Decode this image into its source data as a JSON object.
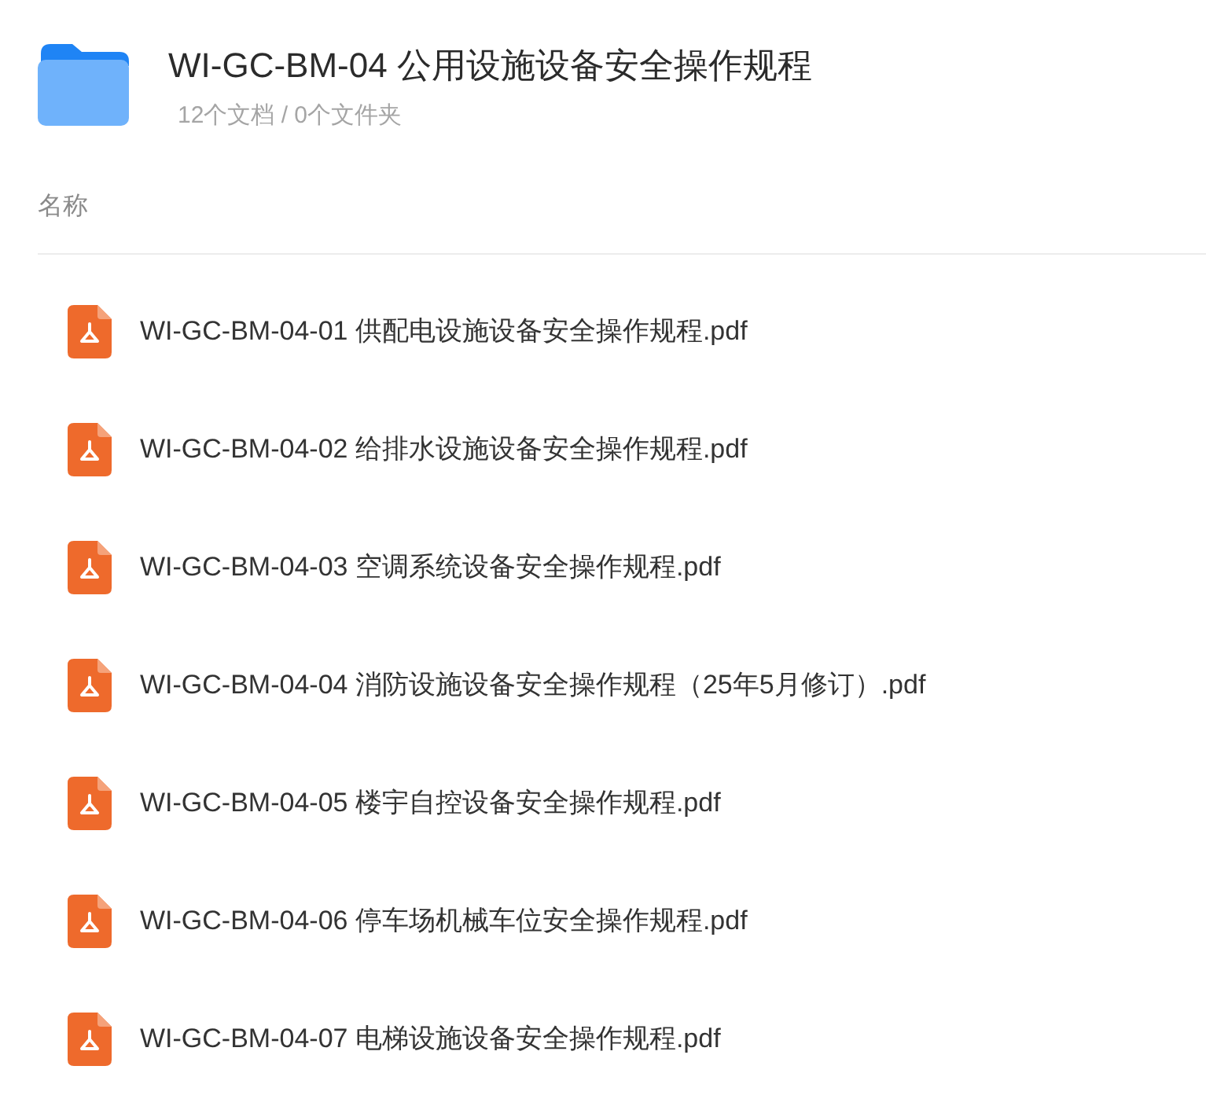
{
  "folder": {
    "title": "WI-GC-BM-04 公用设施设备安全操作规程",
    "summary": "12个文档 / 0个文件夹"
  },
  "list": {
    "column_header": "名称",
    "files": [
      {
        "name": "WI-GC-BM-04-01 供配电设施设备安全操作规程.pdf"
      },
      {
        "name": "WI-GC-BM-04-02 给排水设施设备安全操作规程.pdf"
      },
      {
        "name": "WI-GC-BM-04-03 空调系统设备安全操作规程.pdf"
      },
      {
        "name": "WI-GC-BM-04-04 消防设施设备安全操作规程（25年5月修订）.pdf"
      },
      {
        "name": "WI-GC-BM-04-05 楼宇自控设备安全操作规程.pdf"
      },
      {
        "name": "WI-GC-BM-04-06 停车场机械车位安全操作规程.pdf"
      },
      {
        "name": "WI-GC-BM-04-07 电梯设施设备安全操作规程.pdf"
      }
    ]
  }
}
